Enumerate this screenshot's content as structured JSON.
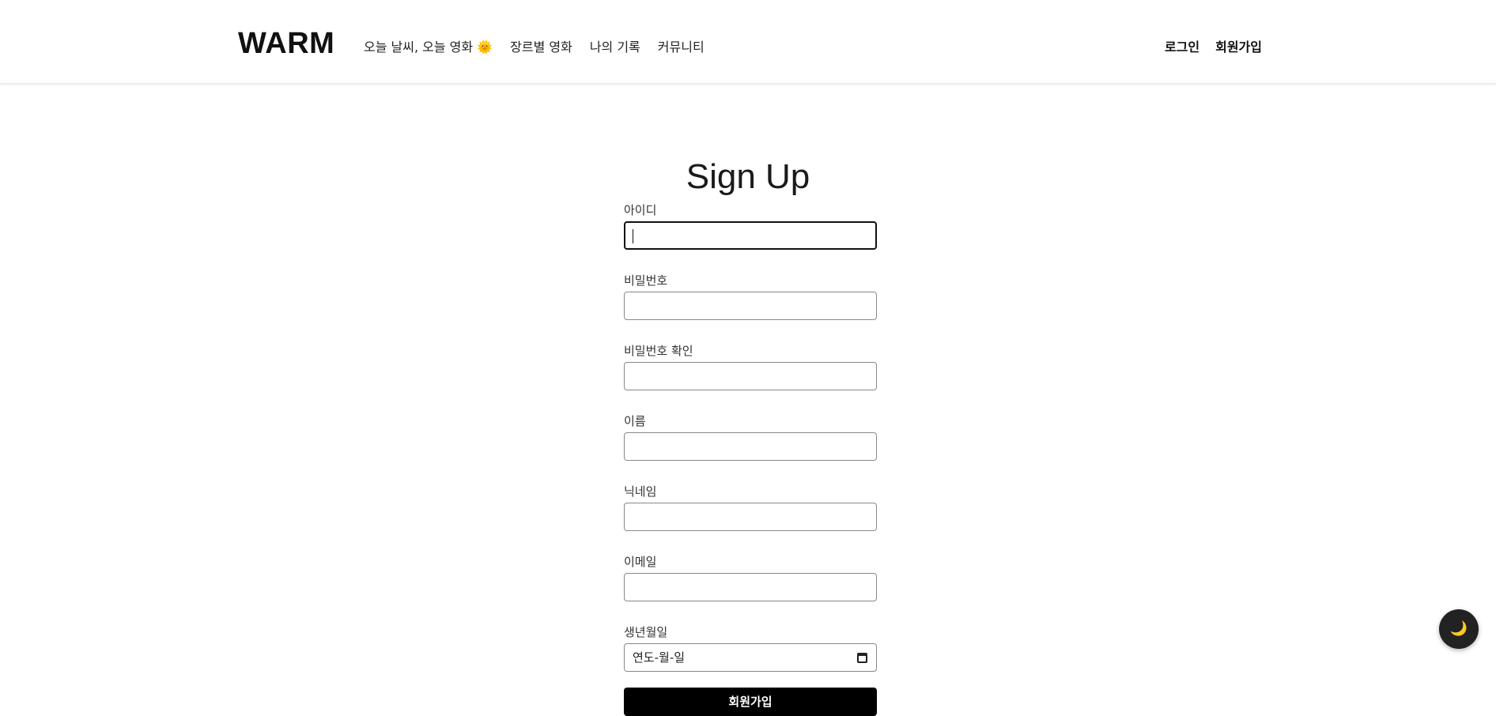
{
  "header": {
    "logo": "WARM",
    "nav_links": [
      "오늘 날씨, 오늘 영화 🌞",
      "장르별 영화",
      "나의 기록",
      "커뮤니티"
    ],
    "login_label": "로그인",
    "signup_label": "회원가입"
  },
  "page_title": "Sign Up",
  "form": {
    "fields": [
      {
        "label": "아이디",
        "value": "",
        "focused": true
      },
      {
        "label": "비밀번호",
        "value": ""
      },
      {
        "label": "비밀번호 확인",
        "value": ""
      },
      {
        "label": "이름",
        "value": ""
      },
      {
        "label": "닉네임",
        "value": ""
      },
      {
        "label": "이메일",
        "value": ""
      },
      {
        "label": "생년월일",
        "placeholder": "연도-월-일"
      }
    ],
    "submit_label": "회원가입"
  },
  "theme_toggle": {
    "icon": "moon-icon",
    "glyph": "🌙"
  },
  "colors": {
    "primary": "#000000",
    "background": "#ffffff",
    "toggle_bg": "#222222"
  }
}
